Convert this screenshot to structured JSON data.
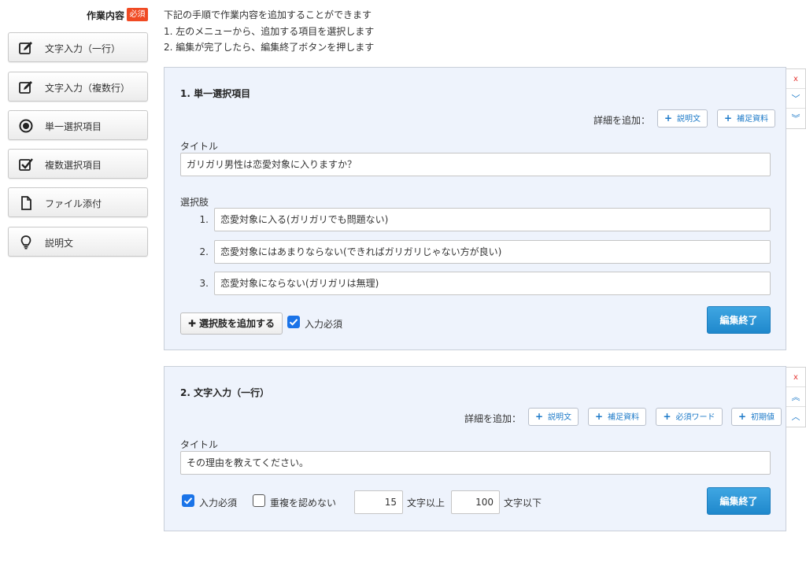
{
  "header": {
    "section_label": "作業内容",
    "required_badge": "必須",
    "instructions": [
      "下記の手順で作業内容を追加することができます",
      "1. 左のメニューから、追加する項目を選択します",
      "2. 編集が完了したら、編集終了ボタンを押します"
    ]
  },
  "sidebar": {
    "items": [
      {
        "label": "文字入力（一行）",
        "icon": "edit-icon"
      },
      {
        "label": "文字入力（複数行）",
        "icon": "edit-icon"
      },
      {
        "label": "単一選択項目",
        "icon": "radio-icon"
      },
      {
        "label": "複数選択項目",
        "icon": "checkbox-icon"
      },
      {
        "label": "ファイル添付",
        "icon": "file-icon"
      },
      {
        "label": "説明文",
        "icon": "lightbulb-icon"
      }
    ]
  },
  "panel1": {
    "title": "1. 単一選択項目",
    "detail_label": "詳細を追加：",
    "detail_buttons": [
      "説明文",
      "補足資料"
    ],
    "title_label": "タイトル",
    "title_value": "ガリガリ男性は恋愛対象に入りますか？",
    "choices_label": "選択肢",
    "choices": [
      {
        "num": "1.",
        "value": "恋愛対象に入る(ガリガリでも問題ない)"
      },
      {
        "num": "2.",
        "value": "恋愛対象にはあまりならない(できればガリガリじゃない方が良い)"
      },
      {
        "num": "3.",
        "value": "恋愛対象にならない(ガリガリは無理)"
      }
    ],
    "add_choice_label": "選択肢を追加する",
    "required_label": "入力必須",
    "required_checked": true,
    "done_label": "編集終了",
    "controls": [
      "x",
      "﹀",
      "︾"
    ]
  },
  "panel2": {
    "title": "2. 文字入力（一行）",
    "detail_label": "詳細を追加：",
    "detail_buttons": [
      "説明文",
      "補足資料",
      "必須ワード",
      "初期値"
    ],
    "title_label": "タイトル",
    "title_value": "その理由を教えてください。",
    "required_label": "入力必須",
    "required_checked": true,
    "no_dup_label": "重複を認めない",
    "no_dup_checked": false,
    "min_value": "15",
    "min_suffix": "文字以上",
    "max_value": "100",
    "max_suffix": "文字以下",
    "done_label": "編集終了",
    "controls": [
      "x",
      "︽",
      "︿"
    ]
  },
  "colors": {
    "accent": "#1f88cc",
    "badge": "#f04a23",
    "panel_bg": "#eef3fc",
    "checkbox": "#1a73e8"
  }
}
